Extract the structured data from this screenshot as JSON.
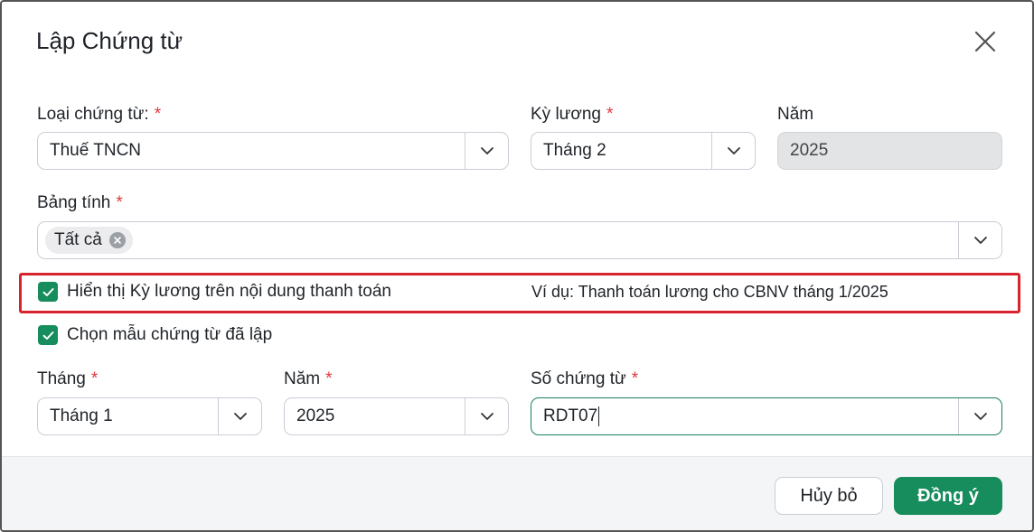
{
  "dialog": {
    "title": "Lập Chứng từ"
  },
  "fields": {
    "loai_chung_tu": {
      "label": "Loại chứng từ:",
      "required": "*",
      "value": "Thuế TNCN"
    },
    "ky_luong": {
      "label": "Kỳ lương",
      "required": "*",
      "value": "Tháng 2"
    },
    "nam_top": {
      "label": "Năm",
      "value": "2025"
    },
    "bang_tinh": {
      "label": "Bảng tính",
      "required": "*",
      "tag": "Tất cả"
    },
    "thang": {
      "label": "Tháng",
      "required": "*",
      "value": "Tháng 1"
    },
    "nam_bottom": {
      "label": "Năm",
      "required": "*",
      "value": "2025"
    },
    "so_chung_tu": {
      "label": "Số chứng từ",
      "required": "*",
      "value": "RDT07"
    }
  },
  "options": {
    "show_period": {
      "label": "Hiển thị Kỳ lương trên nội dung thanh toán",
      "checked": true,
      "example": "Ví dụ: Thanh toán lương cho CBNV tháng 1/2025"
    },
    "choose_template": {
      "label": "Chọn mẫu chứng từ đã lập",
      "checked": true
    }
  },
  "footer": {
    "cancel_label": "Hủy bỏ",
    "ok_label": "Đồng ý"
  },
  "colors": {
    "primary": "#178c5d",
    "required": "#e0383e",
    "highlight": "#d7232e",
    "disabled_bg": "#e3e4e6"
  }
}
